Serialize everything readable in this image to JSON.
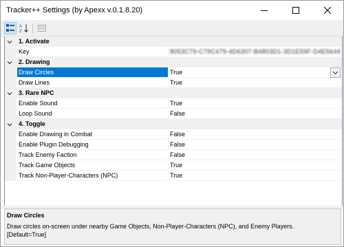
{
  "window": {
    "title": "Tracker++ Settings (by Apexx v.0.1.8.20)"
  },
  "toolbar": {
    "categorized_icon": "categorized-icon",
    "alphabetical_icon": "alphabetical-sort-icon",
    "property_pages_icon": "property-pages-icon"
  },
  "grid": {
    "categories": [
      {
        "label": "1. Activate",
        "properties": [
          {
            "name": "Key",
            "value": "8053C79-C79C479-4D6307-B4803D1-3D1E59F-D4E5644"
          }
        ]
      },
      {
        "label": "2. Drawing",
        "properties": [
          {
            "name": "Draw Circles",
            "value": "True"
          },
          {
            "name": "Draw Lines",
            "value": "True"
          }
        ]
      },
      {
        "label": "3. Rare NPC",
        "properties": [
          {
            "name": "Enable Sound",
            "value": "True"
          },
          {
            "name": "Loop Sound",
            "value": "False"
          }
        ]
      },
      {
        "label": "4. Toggle",
        "properties": [
          {
            "name": "Enable Drawing in Combat",
            "value": "False"
          },
          {
            "name": "Enable Plugin Debugging",
            "value": "False"
          },
          {
            "name": "Track Enemy Faction",
            "value": "False"
          },
          {
            "name": "Track Game Objects",
            "value": "True"
          },
          {
            "name": "Track Non-Player-Characters (NPC)",
            "value": "True"
          }
        ]
      }
    ]
  },
  "help": {
    "title": "Draw Circles",
    "description": "Draw circles on-screen under nearby Game Objects, Non-Player-Characters (NPC), and Enemy Players.",
    "default_text": "[Default=True]"
  },
  "colors": {
    "selection": "#0078d7",
    "category_bg": "#f0f0f0",
    "grid_line": "#f0f0f0"
  }
}
